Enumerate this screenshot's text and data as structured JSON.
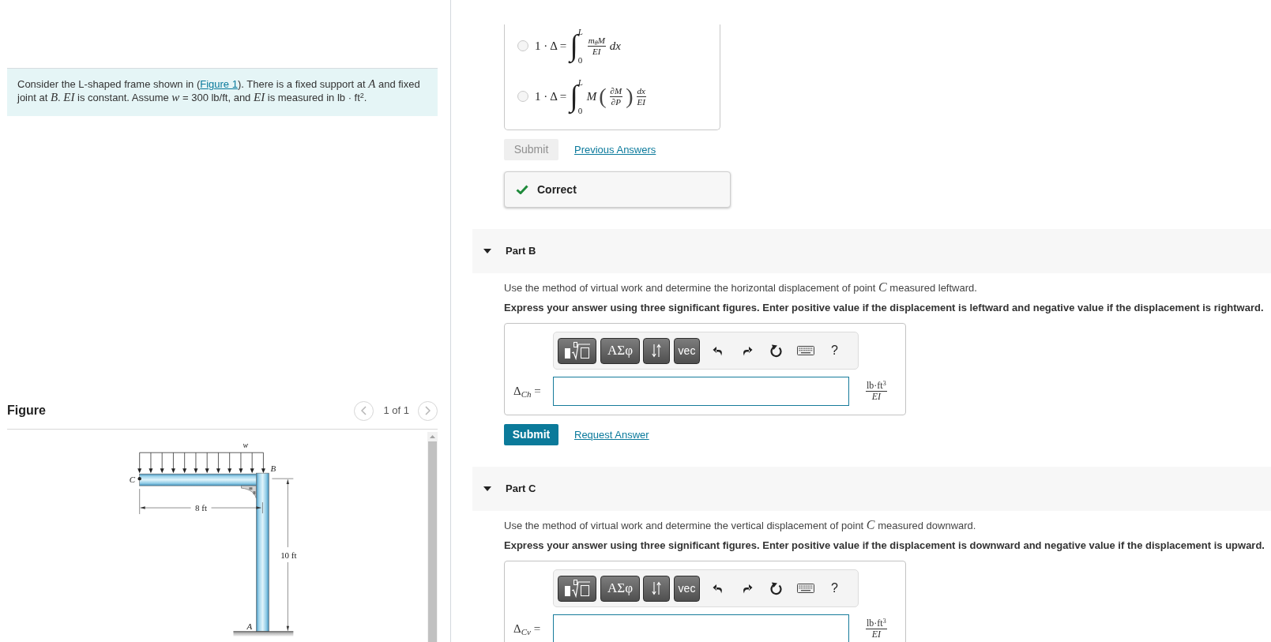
{
  "problem": {
    "text_before_link": "Consider the L-shaped frame shown in (",
    "link": "Figure 1",
    "text_after_link": "). There is a fixed support at *A* and fixed joint at *B*. *EI* is constant. Assume *w* = 300 lb/ft, and *EI* is measured in lb · ft$^{2}$."
  },
  "figure_panel": {
    "title": "Figure",
    "pager": "1 of 1",
    "diagram": {
      "load": "w",
      "point_b": "B",
      "point_c": "C",
      "point_a": "A",
      "horizontal_dimension": "8 ft",
      "vertical_dimension": "10 ft"
    }
  },
  "part_a": {
    "options": [
      {
        "selected": false,
        "formula": [
          {
            "kind": "text",
            "text": "1 · Δ ="
          },
          {
            "kind": "integral",
            "sign": "∫",
            "upper": "L",
            "lower": "0"
          },
          {
            "kind": "fraction",
            "numerator": "m$_{θ}$M",
            "denominator": "EI"
          },
          {
            "kind": "math",
            "text": "dx"
          }
        ]
      },
      {
        "selected": false,
        "formula": [
          {
            "kind": "text",
            "text": "1 · Δ ="
          },
          {
            "kind": "integral",
            "sign": "∫",
            "upper": "L",
            "lower": "0"
          },
          {
            "kind": "math",
            "text": "M"
          },
          {
            "kind": "paren",
            "text": "("
          },
          {
            "kind": "fraction",
            "numerator": "∂M",
            "denominator": "∂P"
          },
          {
            "kind": "paren",
            "text": ")"
          },
          {
            "kind": "fraction",
            "numerator": "dx",
            "denominator": "EI"
          }
        ]
      }
    ],
    "submit": {
      "label": "Submit",
      "disabled": true
    },
    "link": "Previous Answers",
    "feedback": {
      "kind": "correct",
      "text": "Correct"
    }
  },
  "parts": [
    {
      "title": "Part B",
      "expanded": true,
      "prompt": "Use the method of virtual work and determine the horizontal displacement of point *C* measured leftward.",
      "instruction": "Express your answer using three significant figures. Enter positive value if the displacement is leftward and negative value if the displacement is rightward.",
      "toolbar": [
        {
          "kind": "template"
        },
        {
          "kind": "greek",
          "label": "ΑΣφ"
        },
        {
          "kind": "arrows"
        },
        {
          "kind": "dark",
          "label": "vec"
        },
        {
          "kind": "undo"
        },
        {
          "kind": "redo"
        },
        {
          "kind": "reset"
        },
        {
          "kind": "keyboard"
        },
        {
          "kind": "help",
          "label": "?"
        }
      ],
      "answer": {
        "label": "Δ$_{Ch}$ =",
        "units_numerator": "lb·ft$^{3}$",
        "units_denominator": "EI"
      },
      "submit": {
        "label": "Submit",
        "disabled": false
      },
      "link": "Request Answer"
    },
    {
      "title": "Part C",
      "expanded": true,
      "prompt": "Use the method of virtual work and determine the vertical displacement of point *C* measured downward.",
      "instruction": "Express your answer using three significant figures. Enter positive value if the displacement is downward and negative value if the displacement is upward.",
      "toolbar": [
        {
          "kind": "template"
        },
        {
          "kind": "greek",
          "label": "ΑΣφ"
        },
        {
          "kind": "arrows"
        },
        {
          "kind": "dark",
          "label": "vec"
        },
        {
          "kind": "undo"
        },
        {
          "kind": "redo"
        },
        {
          "kind": "reset"
        },
        {
          "kind": "keyboard"
        },
        {
          "kind": "help",
          "label": "?"
        }
      ],
      "answer": {
        "label": "Δ$_{Cv}$ =",
        "units_numerator": "lb·ft$^{3}$",
        "units_denominator": "EI"
      }
    }
  ]
}
